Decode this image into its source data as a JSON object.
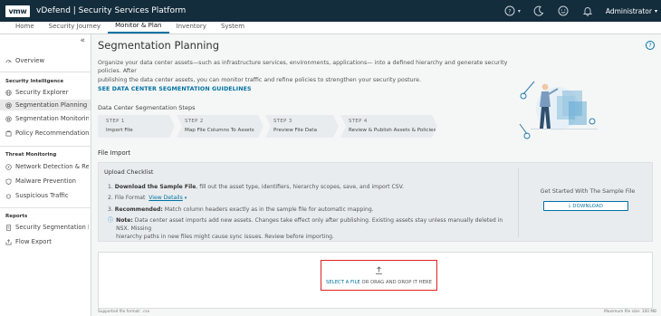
{
  "header": {
    "logo": "vmw",
    "app_title": "vDefend | Security Services Platform",
    "user": "Administrator",
    "icons": [
      "help-circle-icon",
      "moon-icon",
      "smiley-icon",
      "bell-icon"
    ]
  },
  "tabs": [
    {
      "label": "Home",
      "active": false
    },
    {
      "label": "Security Journey",
      "active": false
    },
    {
      "label": "Monitor & Plan",
      "active": true
    },
    {
      "label": "Inventory",
      "active": false
    },
    {
      "label": "System",
      "active": false
    }
  ],
  "sidebar": {
    "collapse_glyph": "«",
    "overview": "Overview",
    "sections": [
      {
        "title": "Security Intelligence",
        "items": [
          "Security Explorer",
          "Segmentation Planning",
          "Segmentation Monitoring",
          "Policy Recommendations"
        ]
      },
      {
        "title": "Threat Monitoring",
        "items": [
          "Network Detection & Res...",
          "Malware Prevention",
          "Suspicious Traffic"
        ]
      },
      {
        "title": "Reports",
        "items": [
          "Security Segmentation R...",
          "Flow Export"
        ]
      }
    ],
    "selected": "Segmentation Planning"
  },
  "page": {
    "title": "Segmentation Planning",
    "help": "?",
    "intro_line1": "Organize your data center assets—such as infrastructure services, environments, applications— into a defined hierarchy and generate security policies. After",
    "intro_line2": "publishing the data center assets, you can monitor traffic and refine policies to strengthen your security posture.",
    "guidelines_link": "SEE DATA CENTER SEGMENTATION GUIDELINES",
    "steps_title": "Data Center Segmentation Steps",
    "steps": [
      {
        "num": "STEP 1",
        "label": "Import File"
      },
      {
        "num": "STEP 2",
        "label": "Map File Columns To Assets"
      },
      {
        "num": "STEP 3",
        "label": "Preview File Data"
      },
      {
        "num": "STEP 4",
        "label": "Review & Publish Assets & Policies"
      }
    ],
    "file_import_title": "File Import",
    "checklist": {
      "title": "Upload Checklist",
      "item1_num": "1.",
      "item1_bold": "Download the Sample File",
      "item1_rest": ", fill out the asset type, identifiers, hierarchy scopes, save, and import CSV.",
      "item2_num": "2.",
      "item2_text": "File Format",
      "item2_link": "View Details",
      "item3_num": "3.",
      "item3_bold": "Recommended:",
      "item3_rest": " Match column headers exactly as in the sample file for automatic mapping.",
      "note_bold": "Note:",
      "note_line1": " Data center asset imports add new assets. Changes take effect only after publishing. Existing assets stay unless manually deleted in NSX. Missing",
      "note_line2": "hierarchy paths in new files might cause sync issues. Review before importing."
    },
    "sample": {
      "title": "Get Started With The Sample File",
      "download_label": "DOWNLOAD"
    },
    "drop": {
      "select_link": "SELECT A FILE",
      "rest": " OR DRAG AND DROP IT HERE"
    },
    "footer_left": "Supported file format: .csv",
    "footer_right": "Maximum file size: 100 MB"
  },
  "colors": {
    "header_bg": "#142d3d",
    "accent": "#0072a3",
    "highlight_box": "#e12222",
    "content_bg": "#f5f6f6"
  }
}
